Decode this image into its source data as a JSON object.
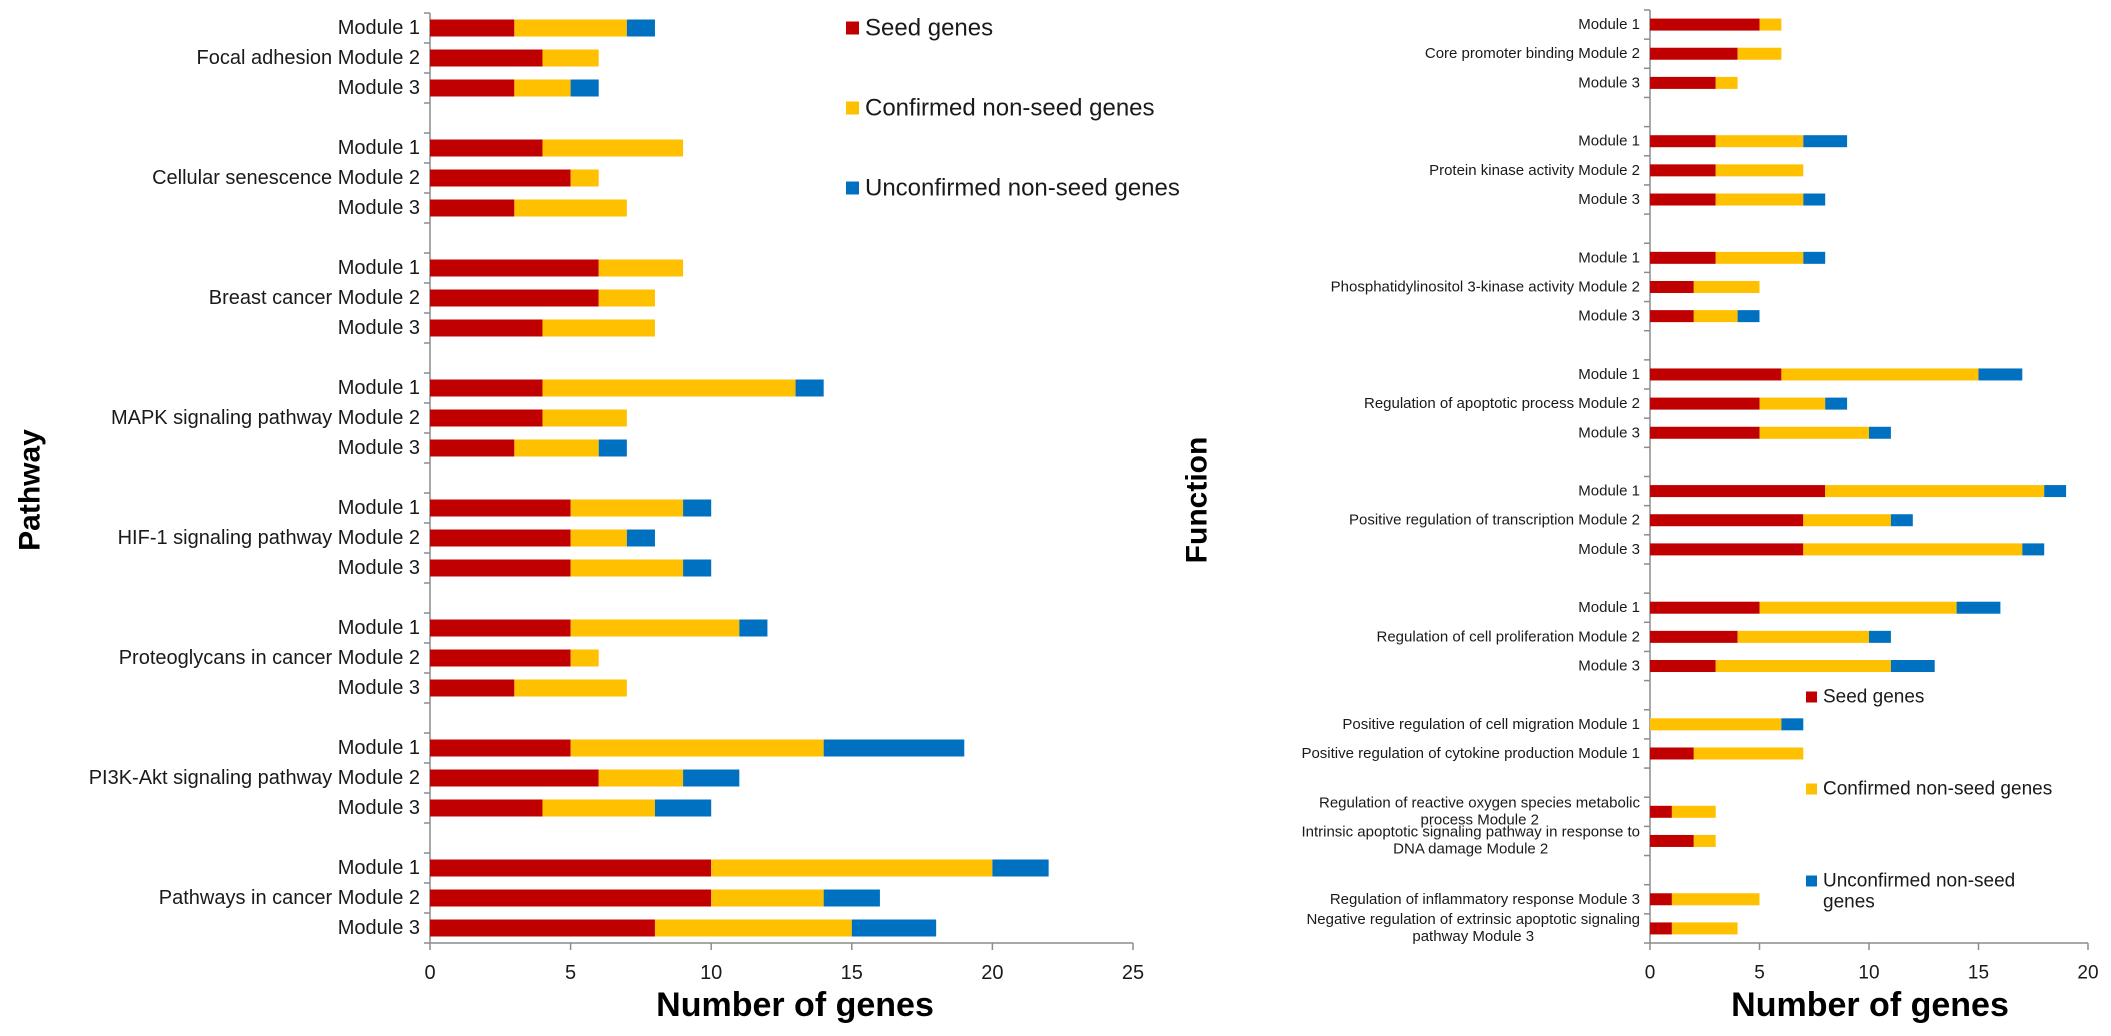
{
  "chart_data": [
    {
      "type": "bar",
      "orientation": "horizontal",
      "stacked": true,
      "title": "",
      "xlabel": "Number of genes",
      "ylabel": "Pathway",
      "xlim": [
        0,
        25
      ],
      "xticks": [
        0,
        5,
        10,
        15,
        20,
        25
      ],
      "grid": false,
      "legend_position": "top-right",
      "legend": [
        "Seed genes",
        "Confirmed non-seed genes",
        "Unconfirmed non-seed genes"
      ],
      "series_colors": [
        "#C00000",
        "#FFC000",
        "#0070C0"
      ],
      "groups": [
        {
          "name": "Focal adhesion",
          "modules": [
            {
              "label": "Module 1",
              "values": [
                3,
                4,
                1
              ]
            },
            {
              "label": "Module 2",
              "values": [
                4,
                2,
                0
              ]
            },
            {
              "label": "Module 3",
              "values": [
                3,
                2,
                1
              ]
            }
          ]
        },
        {
          "name": "Cellular senescence",
          "modules": [
            {
              "label": "Module 1",
              "values": [
                4,
                5,
                0
              ]
            },
            {
              "label": "Module 2",
              "values": [
                5,
                1,
                0
              ]
            },
            {
              "label": "Module 3",
              "values": [
                3,
                4,
                0
              ]
            }
          ]
        },
        {
          "name": "Breast cancer",
          "modules": [
            {
              "label": "Module 1",
              "values": [
                6,
                3,
                0
              ]
            },
            {
              "label": "Module 2",
              "values": [
                6,
                2,
                0
              ]
            },
            {
              "label": "Module 3",
              "values": [
                4,
                4,
                0
              ]
            }
          ]
        },
        {
          "name": "MAPK signaling pathway",
          "modules": [
            {
              "label": "Module 1",
              "values": [
                4,
                9,
                1
              ]
            },
            {
              "label": "Module 2",
              "values": [
                4,
                3,
                0
              ]
            },
            {
              "label": "Module 3",
              "values": [
                3,
                3,
                1
              ]
            }
          ]
        },
        {
          "name": "HIF-1 signaling pathway",
          "modules": [
            {
              "label": "Module 1",
              "values": [
                5,
                4,
                1
              ]
            },
            {
              "label": "Module 2",
              "values": [
                5,
                2,
                1
              ]
            },
            {
              "label": "Module 3",
              "values": [
                5,
                4,
                1
              ]
            }
          ]
        },
        {
          "name": "Proteoglycans in cancer",
          "modules": [
            {
              "label": "Module 1",
              "values": [
                5,
                6,
                1
              ]
            },
            {
              "label": "Module 2",
              "values": [
                5,
                1,
                0
              ]
            },
            {
              "label": "Module 3",
              "values": [
                3,
                4,
                0
              ]
            }
          ]
        },
        {
          "name": "PI3K-Akt signaling pathway",
          "modules": [
            {
              "label": "Module 1",
              "values": [
                5,
                9,
                5
              ]
            },
            {
              "label": "Module 2",
              "values": [
                6,
                3,
                2
              ]
            },
            {
              "label": "Module 3",
              "values": [
                4,
                4,
                2
              ]
            }
          ]
        },
        {
          "name": "Pathways in cancer",
          "modules": [
            {
              "label": "Module 1",
              "values": [
                10,
                10,
                2
              ]
            },
            {
              "label": "Module 2",
              "values": [
                10,
                4,
                2
              ]
            },
            {
              "label": "Module 3",
              "values": [
                8,
                7,
                3
              ]
            }
          ]
        }
      ]
    },
    {
      "type": "bar",
      "orientation": "horizontal",
      "stacked": true,
      "title": "",
      "xlabel": "Number of genes",
      "ylabel": "Function",
      "xlim": [
        0,
        20
      ],
      "xticks": [
        0,
        5,
        10,
        15,
        20
      ],
      "grid": false,
      "legend_position": "bottom-right",
      "legend": [
        "Seed genes",
        "Confirmed non-seed genes",
        "Unconfirmed non-seed genes"
      ],
      "series_colors": [
        "#C00000",
        "#FFC000",
        "#0070C0"
      ],
      "groups": [
        {
          "name": "Core promoter binding",
          "modules": [
            {
              "label": "Module 1",
              "values": [
                5,
                1,
                0
              ]
            },
            {
              "label": "Module 2",
              "values": [
                4,
                2,
                0
              ]
            },
            {
              "label": "Module 3",
              "values": [
                3,
                1,
                0
              ]
            }
          ]
        },
        {
          "name": "Protein kinase activity",
          "modules": [
            {
              "label": "Module 1",
              "values": [
                3,
                4,
                2
              ]
            },
            {
              "label": "Module 2",
              "values": [
                3,
                4,
                0
              ]
            },
            {
              "label": "Module 3",
              "values": [
                3,
                4,
                1
              ]
            }
          ]
        },
        {
          "name": "Phosphatidylinositol 3-kinase activity",
          "modules": [
            {
              "label": "Module 1",
              "values": [
                3,
                4,
                1
              ]
            },
            {
              "label": "Module 2",
              "values": [
                2,
                3,
                0
              ]
            },
            {
              "label": "Module 3",
              "values": [
                2,
                2,
                1
              ]
            }
          ]
        },
        {
          "name": "Regulation of apoptotic process",
          "modules": [
            {
              "label": "Module 1",
              "values": [
                6,
                9,
                2
              ]
            },
            {
              "label": "Module 2",
              "values": [
                5,
                3,
                1
              ]
            },
            {
              "label": "Module 3",
              "values": [
                5,
                5,
                1
              ]
            }
          ]
        },
        {
          "name": "Positive regulation of transcription",
          "modules": [
            {
              "label": "Module 1",
              "values": [
                8,
                10,
                1
              ]
            },
            {
              "label": "Module 2",
              "values": [
                7,
                4,
                1
              ]
            },
            {
              "label": "Module 3",
              "values": [
                7,
                10,
                1
              ]
            }
          ]
        },
        {
          "name": "Regulation of cell proliferation",
          "modules": [
            {
              "label": "Module 1",
              "values": [
                5,
                9,
                2
              ]
            },
            {
              "label": "Module 2",
              "values": [
                4,
                6,
                1
              ]
            },
            {
              "label": "Module 3",
              "values": [
                3,
                8,
                2
              ]
            }
          ]
        },
        {
          "name": "",
          "modules": [
            {
              "label": "Positive regulation of cell migration Module 1",
              "values": [
                0,
                6,
                1
              ]
            },
            {
              "label": "Positive regulation of cytokine production Module 1",
              "values": [
                2,
                5,
                0
              ]
            }
          ]
        },
        {
          "name": "",
          "modules": [
            {
              "label": "Regulation of reactive oxygen species metabolic|process Module 2",
              "values": [
                1,
                2,
                0
              ]
            },
            {
              "label": "Intrinsic apoptotic signaling pathway in response to|DNA damage Module 2",
              "values": [
                2,
                1,
                0
              ]
            }
          ]
        },
        {
          "name": "",
          "modules": [
            {
              "label": "Regulation of inflammatory response Module 3",
              "values": [
                1,
                4,
                0
              ]
            },
            {
              "label": "Negative regulation of extrinsic apoptotic signaling|pathway Module 3",
              "values": [
                1,
                3,
                0
              ]
            }
          ]
        }
      ]
    }
  ]
}
